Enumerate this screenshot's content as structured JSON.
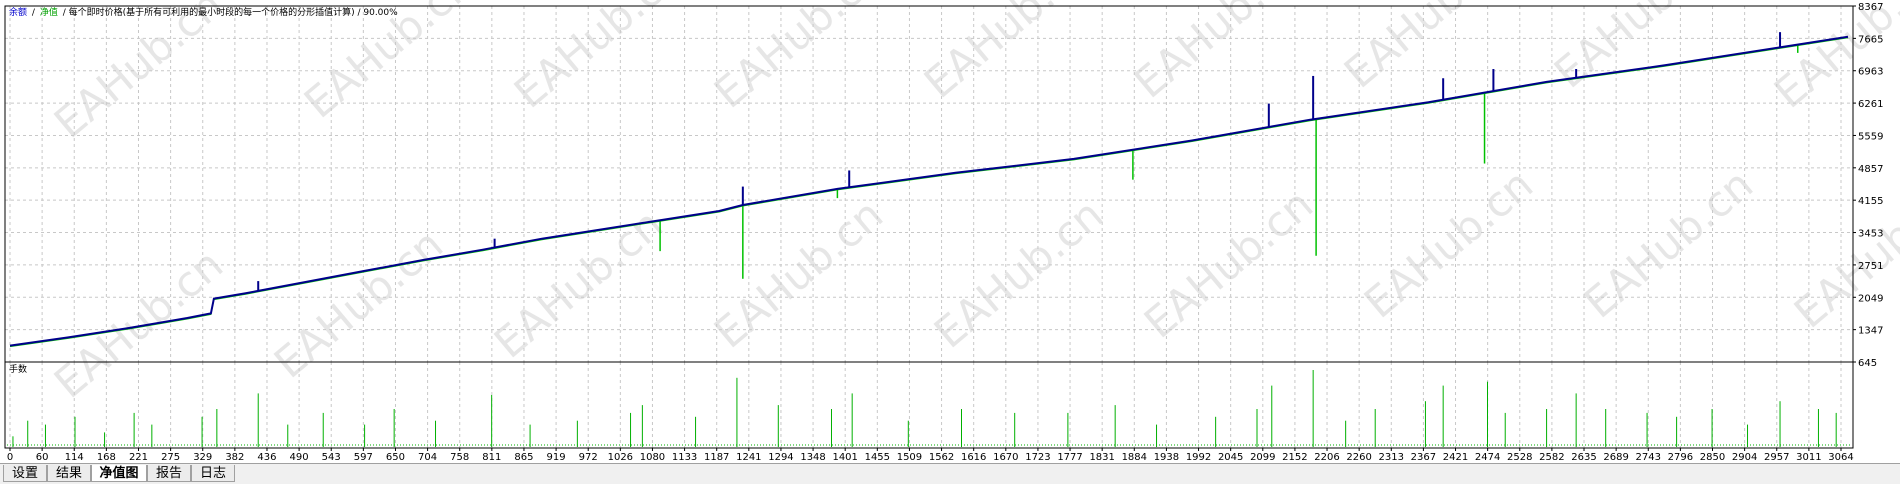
{
  "chart_data": {
    "type": "line",
    "legend": {
      "balance_label": "余额",
      "separator": "/",
      "equity_label": "净值",
      "model_text": "/ 每个即时价格(基于所有可利用的最小时段的每一个价格的分形插值计算) / 90.00%"
    },
    "lower_panel_label": "手数",
    "watermark": "EAHub.cn",
    "colors": {
      "balance": "#00008b",
      "equity": "#00c000",
      "lots": "#00b000",
      "grid": "#c8c8c8",
      "watermark": "#e6e6e6"
    },
    "x_ticks": [
      "0",
      "60",
      "114",
      "168",
      "221",
      "275",
      "329",
      "382",
      "436",
      "490",
      "543",
      "597",
      "650",
      "704",
      "758",
      "811",
      "865",
      "919",
      "972",
      "1026",
      "1080",
      "1133",
      "1187",
      "1241",
      "1294",
      "1348",
      "1401",
      "1455",
      "1509",
      "1562",
      "1616",
      "1670",
      "1723",
      "1777",
      "1831",
      "1884",
      "1938",
      "1992",
      "2045",
      "2099",
      "2152",
      "2206",
      "2260",
      "2313",
      "2367",
      "2421",
      "2474",
      "2528",
      "2582",
      "2635",
      "2689",
      "2743",
      "2796",
      "2850",
      "2904",
      "2957",
      "3011",
      "3064"
    ],
    "y_ticks": [
      "8367",
      "7665",
      "6963",
      "6261",
      "5559",
      "4857",
      "4155",
      "3453",
      "2751",
      "2049",
      "1347",
      "645"
    ],
    "ylim": [
      645,
      8367
    ],
    "xlim": [
      0,
      3110
    ],
    "series": [
      {
        "name": "余额",
        "x": [
          0,
          100,
          200,
          300,
          340,
          345,
          400,
          500,
          600,
          700,
          800,
          900,
          1000,
          1100,
          1200,
          1240,
          1400,
          1600,
          1800,
          2000,
          2200,
          2400,
          2600,
          2800,
          3000,
          3110
        ],
        "values": [
          1000,
          1180,
          1380,
          1600,
          1700,
          2020,
          2140,
          2380,
          2620,
          2860,
          3080,
          3320,
          3520,
          3720,
          3920,
          4050,
          4400,
          4750,
          5050,
          5450,
          5900,
          6280,
          6720,
          7080,
          7480,
          7700
        ]
      }
    ],
    "equity_spikes": [
      {
        "x": 1100,
        "value": 3050
      },
      {
        "x": 1240,
        "value": 2450
      },
      {
        "x": 1400,
        "value": 4200
      },
      {
        "x": 1900,
        "value": 4600
      },
      {
        "x": 2210,
        "value": 2950
      },
      {
        "x": 2495,
        "value": 4950
      },
      {
        "x": 3025,
        "value": 7350
      }
    ],
    "balance_spikes": [
      {
        "x": 420,
        "value": 2400
      },
      {
        "x": 820,
        "value": 3320
      },
      {
        "x": 1240,
        "value": 4450
      },
      {
        "x": 1420,
        "value": 4800
      },
      {
        "x": 2130,
        "value": 6250
      },
      {
        "x": 2205,
        "value": 6850
      },
      {
        "x": 2425,
        "value": 6800
      },
      {
        "x": 2510,
        "value": 7000
      },
      {
        "x": 2650,
        "value": 7000
      },
      {
        "x": 2995,
        "value": 7800
      }
    ],
    "lots_spikes": [
      {
        "x": 5,
        "value": 0.15
      },
      {
        "x": 30,
        "value": 0.35
      },
      {
        "x": 60,
        "value": 0.3
      },
      {
        "x": 110,
        "value": 0.4
      },
      {
        "x": 160,
        "value": 0.2
      },
      {
        "x": 210,
        "value": 0.45
      },
      {
        "x": 240,
        "value": 0.3
      },
      {
        "x": 325,
        "value": 0.4
      },
      {
        "x": 350,
        "value": 0.5
      },
      {
        "x": 420,
        "value": 0.7
      },
      {
        "x": 470,
        "value": 0.3
      },
      {
        "x": 530,
        "value": 0.45
      },
      {
        "x": 600,
        "value": 0.3
      },
      {
        "x": 650,
        "value": 0.5
      },
      {
        "x": 720,
        "value": 0.35
      },
      {
        "x": 815,
        "value": 0.68
      },
      {
        "x": 880,
        "value": 0.3
      },
      {
        "x": 960,
        "value": 0.35
      },
      {
        "x": 1050,
        "value": 0.45
      },
      {
        "x": 1070,
        "value": 0.55
      },
      {
        "x": 1160,
        "value": 0.4
      },
      {
        "x": 1230,
        "value": 0.9
      },
      {
        "x": 1300,
        "value": 0.55
      },
      {
        "x": 1390,
        "value": 0.5
      },
      {
        "x": 1425,
        "value": 0.7
      },
      {
        "x": 1520,
        "value": 0.35
      },
      {
        "x": 1610,
        "value": 0.5
      },
      {
        "x": 1700,
        "value": 0.45
      },
      {
        "x": 1790,
        "value": 0.45
      },
      {
        "x": 1870,
        "value": 0.55
      },
      {
        "x": 1940,
        "value": 0.3
      },
      {
        "x": 2040,
        "value": 0.4
      },
      {
        "x": 2110,
        "value": 0.5
      },
      {
        "x": 2135,
        "value": 0.8
      },
      {
        "x": 2205,
        "value": 1.0
      },
      {
        "x": 2260,
        "value": 0.35
      },
      {
        "x": 2310,
        "value": 0.5
      },
      {
        "x": 2395,
        "value": 0.6
      },
      {
        "x": 2425,
        "value": 0.8
      },
      {
        "x": 2500,
        "value": 0.85
      },
      {
        "x": 2530,
        "value": 0.45
      },
      {
        "x": 2600,
        "value": 0.5
      },
      {
        "x": 2650,
        "value": 0.7
      },
      {
        "x": 2700,
        "value": 0.5
      },
      {
        "x": 2770,
        "value": 0.45
      },
      {
        "x": 2820,
        "value": 0.4
      },
      {
        "x": 2880,
        "value": 0.5
      },
      {
        "x": 2940,
        "value": 0.3
      },
      {
        "x": 2995,
        "value": 0.6
      },
      {
        "x": 3060,
        "value": 0.5
      },
      {
        "x": 3090,
        "value": 0.45
      }
    ]
  },
  "tabs": [
    {
      "label": "设置",
      "active": false
    },
    {
      "label": "结果",
      "active": false
    },
    {
      "label": "净值图",
      "active": true
    },
    {
      "label": "报告",
      "active": false
    },
    {
      "label": "日志",
      "active": false
    }
  ]
}
